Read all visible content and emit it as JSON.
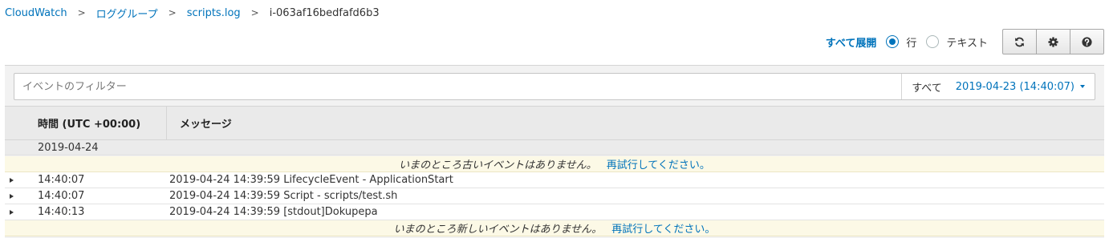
{
  "breadcrumb": {
    "items": [
      "CloudWatch",
      "ロググループ",
      "scripts.log"
    ],
    "separator": ">",
    "current": "i-063af16bedfafd6b3"
  },
  "controls": {
    "expand_all": "すべて展開",
    "view_options": [
      {
        "label": "行",
        "checked": true
      },
      {
        "label": "テキスト",
        "checked": false
      }
    ],
    "buttons": [
      "refresh-icon",
      "gear-icon",
      "help-icon"
    ]
  },
  "filter": {
    "placeholder": "イベントのフィルター",
    "value": "",
    "range_all": "すべて",
    "range_date": "2019-04-23 (14:40:07)"
  },
  "table": {
    "headers": {
      "time": "時間 (UTC +00:00)",
      "message": "メッセージ"
    },
    "date_group": "2019-04-24",
    "notice_older": {
      "text": "いまのところ古いイベントはありません。",
      "retry": "再試行してください。"
    },
    "rows": [
      {
        "time": "14:40:07",
        "message": "2019-04-24 14:39:59 LifecycleEvent - ApplicationStart"
      },
      {
        "time": "14:40:07",
        "message": "2019-04-24 14:39:59 Script - scripts/test.sh"
      },
      {
        "time": "14:40:13",
        "message": "2019-04-24 14:39:59 [stdout]Dokupepa"
      }
    ],
    "notice_newer": {
      "text": "いまのところ新しいイベントはありません。",
      "retry": "再試行してください。"
    }
  },
  "colors": {
    "link": "#0073bb",
    "notice_bg": "#fcf9e6",
    "header_bg": "#eaeaea"
  }
}
